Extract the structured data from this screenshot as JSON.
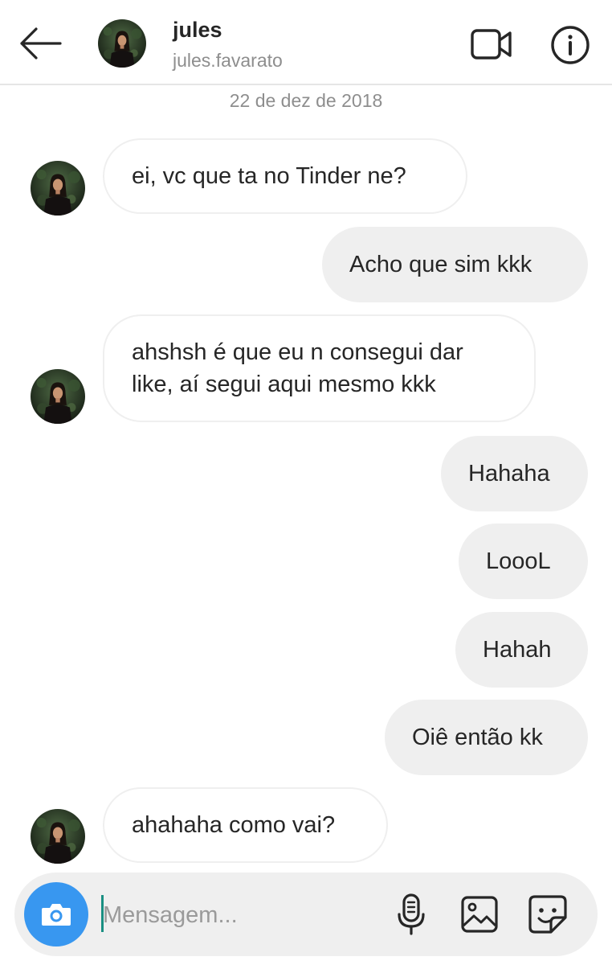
{
  "header": {
    "title": "jules",
    "subtitle": "jules.favarato",
    "back_icon": "arrow-left-icon",
    "video_icon": "video-camera-icon",
    "info_icon": "info-icon"
  },
  "date_separator": "22 de dez de 2018",
  "messages": [
    {
      "direction": "incoming",
      "text": "ei, vc que ta no Tinder ne?"
    },
    {
      "direction": "outgoing",
      "text": "Acho que sim kkk"
    },
    {
      "direction": "incoming",
      "lines": [
        "ahshsh é que eu n consegui dar",
        "like, aí segui aqui mesmo kkk"
      ]
    },
    {
      "direction": "outgoing",
      "text": "Hahaha"
    },
    {
      "direction": "outgoing",
      "text": "LoooL"
    },
    {
      "direction": "outgoing",
      "text": "Hahah"
    },
    {
      "direction": "outgoing",
      "text": "Oiê então kk"
    },
    {
      "direction": "incoming",
      "text": "ahahaha como vai?"
    }
  ],
  "composer": {
    "placeholder": "Mensagem...",
    "value": "",
    "camera_icon": "camera-icon",
    "mic_icon": "microphone-icon",
    "gallery_icon": "image-icon",
    "sticker_icon": "sticker-icon"
  },
  "colors": {
    "accent": "#3897f0",
    "outgoing_bubble": "#efefef",
    "incoming_border": "#efefef",
    "muted_text": "#8e8e8e",
    "text": "#262626"
  }
}
